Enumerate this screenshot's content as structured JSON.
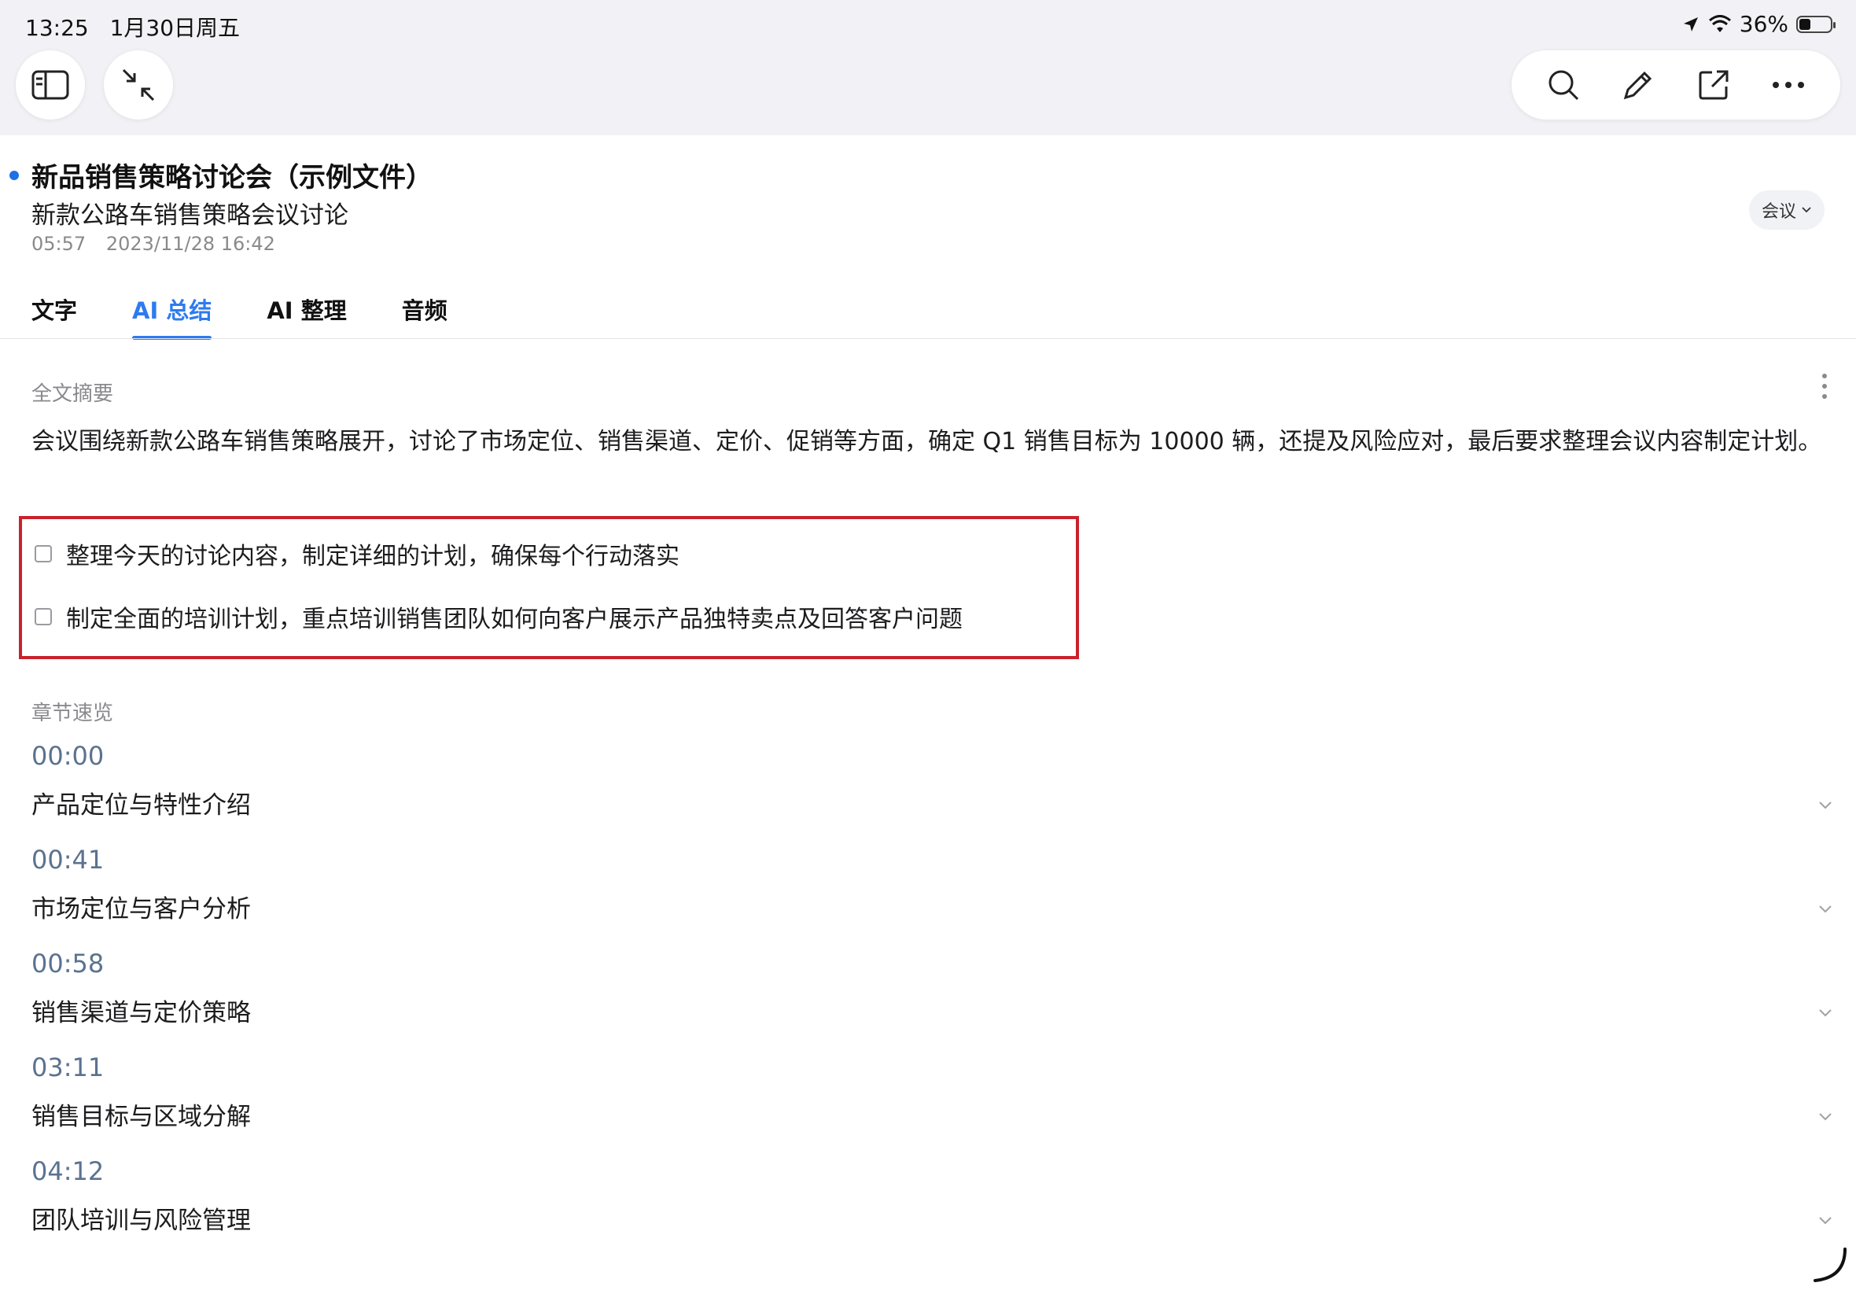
{
  "status_bar": {
    "time": "13:25",
    "date": "1月30日周五",
    "battery": "36%",
    "battery_level": 0.36
  },
  "note": {
    "title": "新品销售策略讨论会（示例文件）",
    "subtitle": "新款公路车销售策略会议讨论",
    "duration": "05:57",
    "datetime": "2023/11/28 16:42",
    "tag": "会议"
  },
  "tabs": [
    {
      "label": "文字",
      "active": false
    },
    {
      "label": "AI 总结",
      "active": true
    },
    {
      "label": "AI 整理",
      "active": false
    },
    {
      "label": "音频",
      "active": false
    }
  ],
  "summary": {
    "label": "全文摘要",
    "text": "会议围绕新款公路车销售策略展开，讨论了市场定位、销售渠道、定价、促销等方面，确定 Q1 销售目标为 10000 辆，还提及风险应对，最后要求整理会议内容制定计划。"
  },
  "todos": [
    {
      "text": "整理今天的讨论内容，制定详细的计划，确保每个行动落实",
      "checked": false
    },
    {
      "text": "制定全面的培训计划，重点培训销售团队如何向客户展示产品独特卖点及回答客户问题",
      "checked": false
    }
  ],
  "chapters": {
    "label": "章节速览",
    "items": [
      {
        "time": "00:00",
        "title": "产品定位与特性介绍"
      },
      {
        "time": "00:41",
        "title": "市场定位与客户分析"
      },
      {
        "time": "00:58",
        "title": "销售渠道与定价策略"
      },
      {
        "time": "03:11",
        "title": "销售目标与区域分解"
      },
      {
        "time": "04:12",
        "title": "团队培训与风险管理"
      }
    ]
  },
  "colors": {
    "accent": "#2e7bf0",
    "highlight_border": "#c8222c",
    "dot": "#1f6fe5"
  },
  "icons": {
    "sidebar": "sidebar-icon",
    "collapse": "collapse-arrows-icon",
    "search": "search-icon",
    "edit": "pencil-icon",
    "share": "share-icon",
    "more": "more-icon"
  }
}
